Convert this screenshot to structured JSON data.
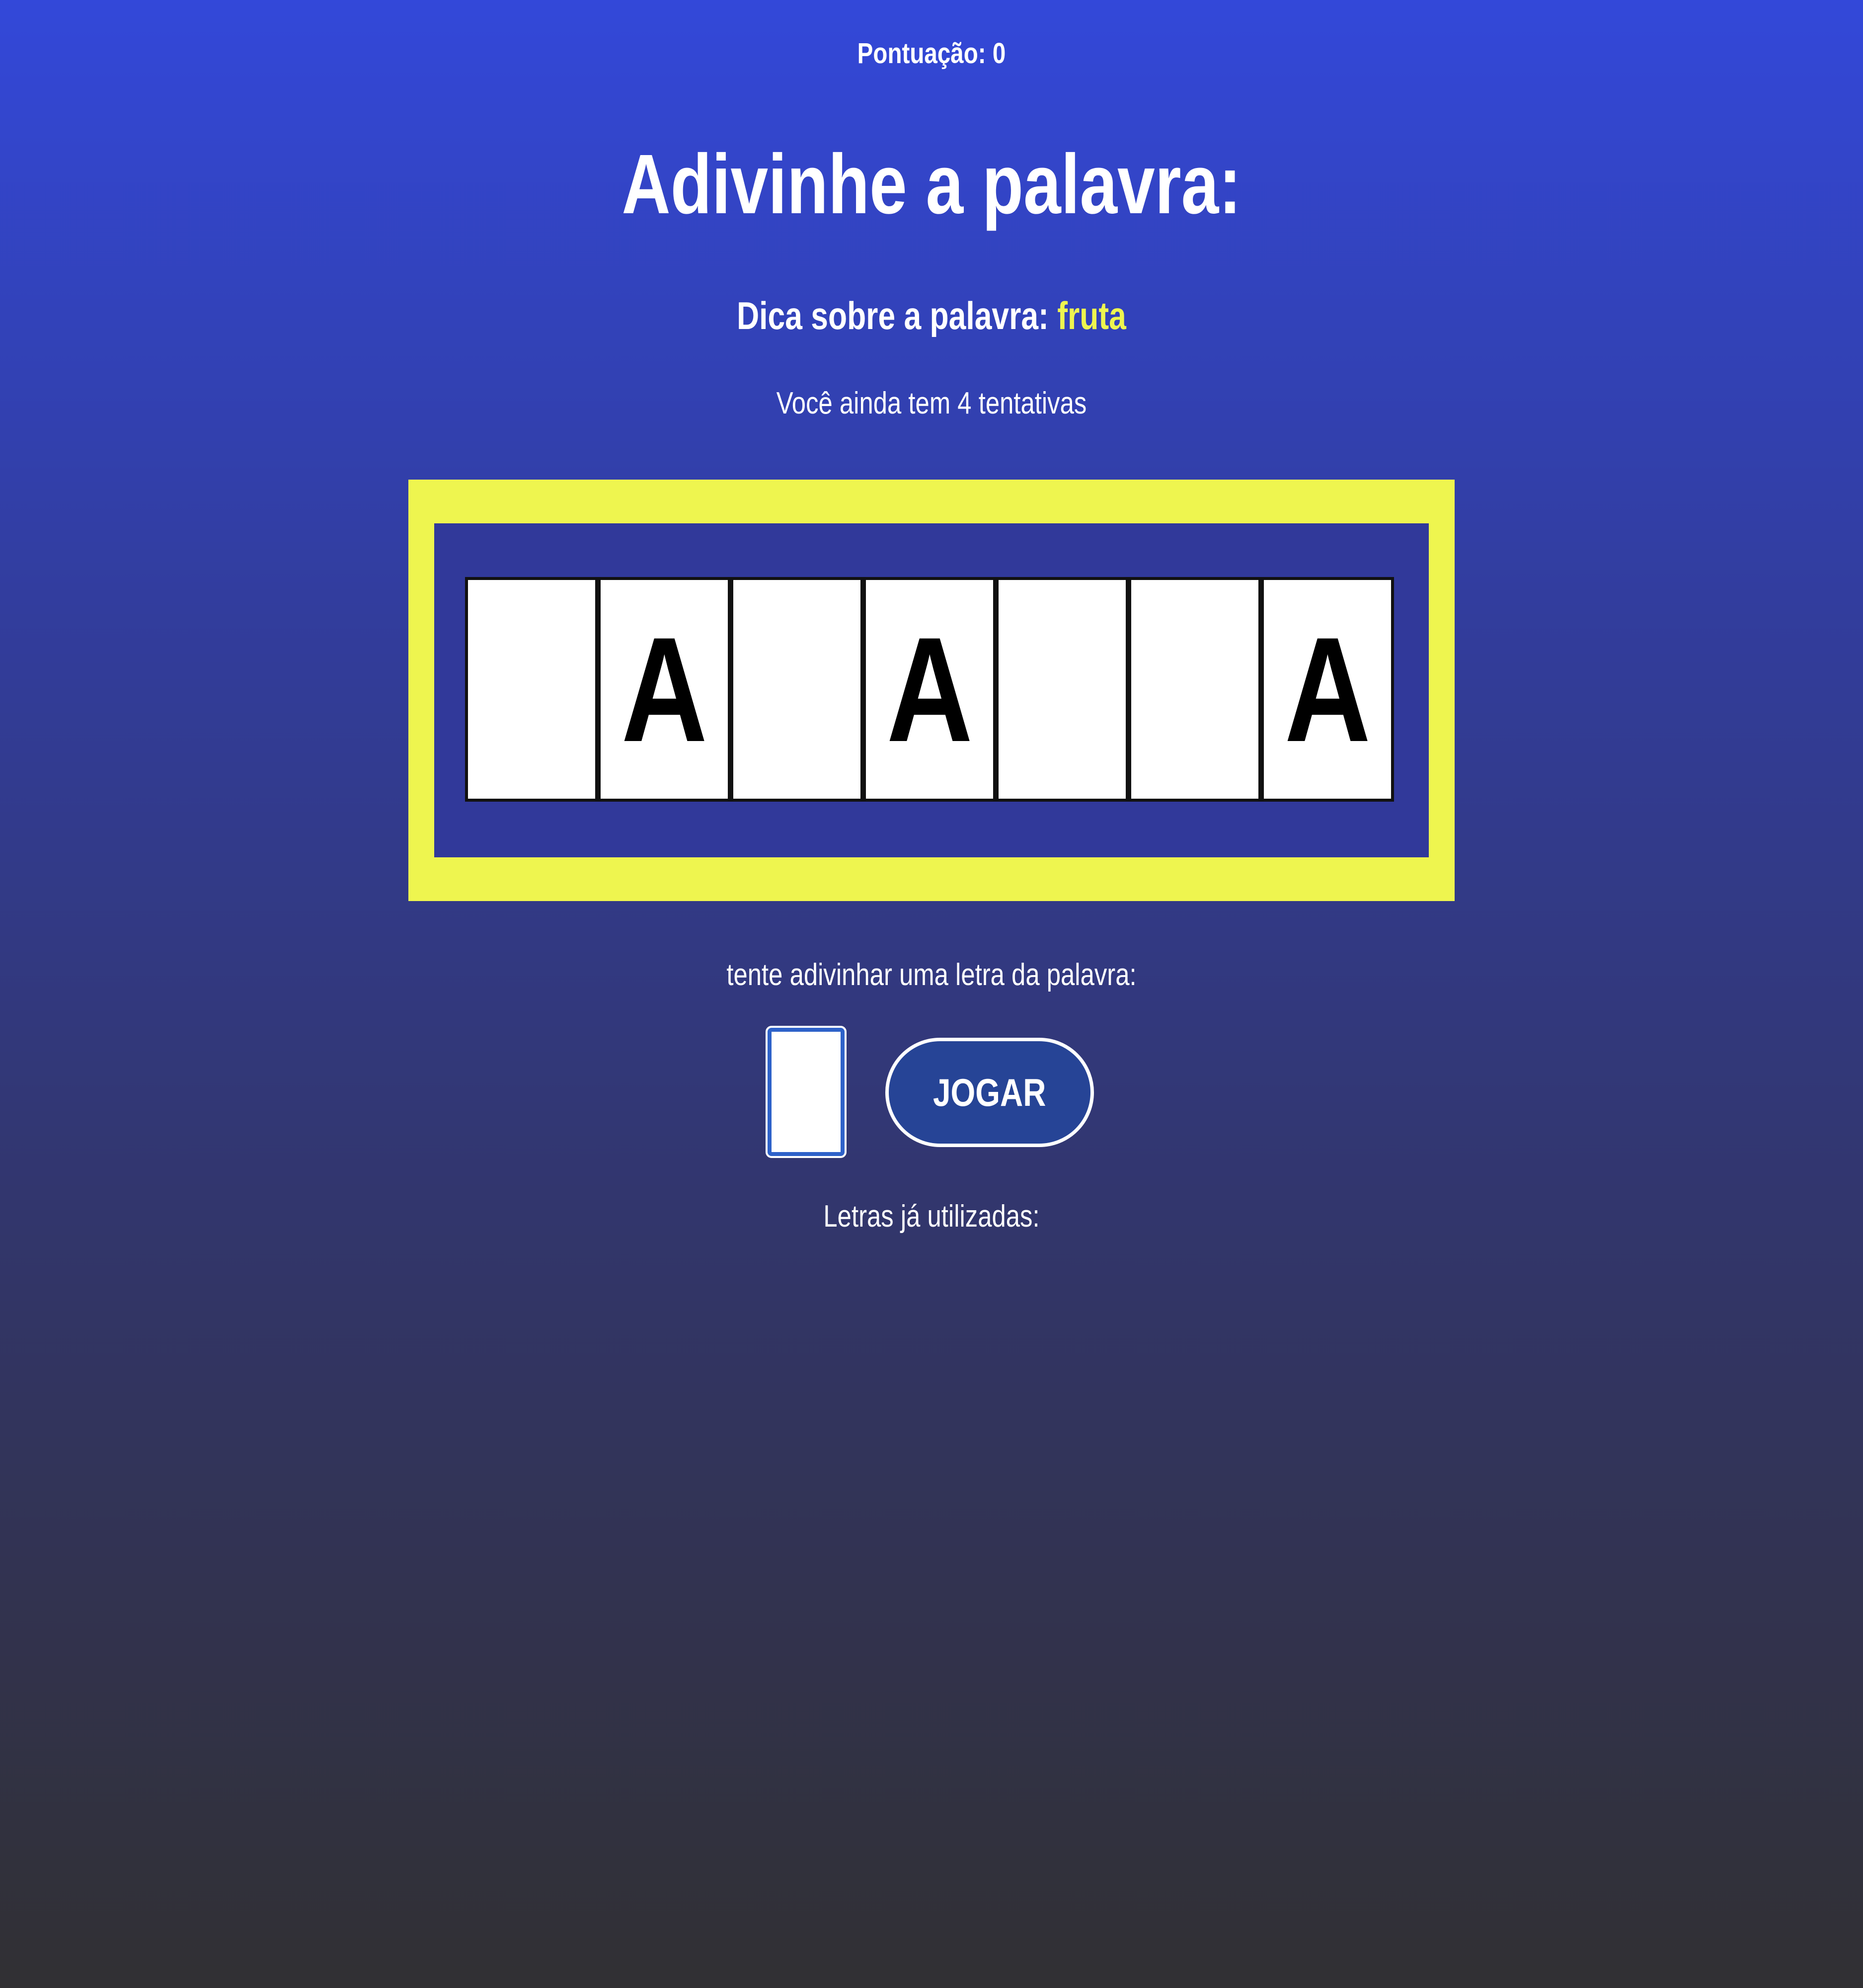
{
  "score": {
    "label": "Pontuação: 0"
  },
  "title": "Adivinhe a palavra:",
  "hint": {
    "label": "Dica sobre a palavra:",
    "word": "fruta"
  },
  "attempts_text": "Você ainda tem 4 tentativas",
  "board": {
    "tiles": [
      "",
      "A",
      "",
      "A",
      "",
      "",
      "A"
    ]
  },
  "prompt": "tente adivinhar uma letra da palavra:",
  "input": {
    "value": "",
    "placeholder": ""
  },
  "play_button_label": "JOGAR",
  "used_letters_label": "Letras já utilizadas:",
  "colors": {
    "accent_yellow": "#eef54f",
    "board_blue": "#31399a",
    "button_blue": "#264496"
  }
}
